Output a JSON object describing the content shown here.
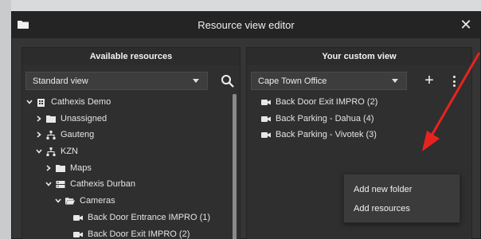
{
  "dialog": {
    "title": "Resource view editor",
    "close_label": "✕"
  },
  "left_panel": {
    "header": "Available resources",
    "view_select": "Standard view",
    "tree": [
      {
        "label": "Cathexis Demo",
        "icon": "building-icon",
        "expanded": true
      },
      {
        "label": "Unassigned",
        "icon": "folder-icon",
        "expanded": false
      },
      {
        "label": "Gauteng",
        "icon": "network-icon",
        "expanded": false
      },
      {
        "label": "KZN",
        "icon": "network-icon",
        "expanded": true
      },
      {
        "label": "Maps",
        "icon": "folder-icon",
        "expanded": false
      },
      {
        "label": "Cathexis Durban",
        "icon": "server-icon",
        "expanded": true
      },
      {
        "label": "Cameras",
        "icon": "folder-icon",
        "expanded": true
      },
      {
        "label": "Back Door Entrance IMPRO (1)",
        "icon": "camera-icon"
      },
      {
        "label": "Back Door Exit IMPRO (2)",
        "icon": "camera-icon"
      }
    ]
  },
  "right_panel": {
    "header": "Your custom view",
    "view_select": "Cape Town Office",
    "plus_label": "+",
    "items": [
      {
        "label": "Back Door Exit IMPRO (2)",
        "icon": "camera-icon"
      },
      {
        "label": "Back Parking - Dahua (4)",
        "icon": "camera-icon"
      },
      {
        "label": "Back Parking - Vivotek (3)",
        "icon": "camera-icon"
      }
    ]
  },
  "context_menu": {
    "items": [
      "Add new folder",
      "Add resources"
    ]
  },
  "colors": {
    "dialog_bg": "#353535",
    "titlebar_bg": "#242424",
    "panel_bg": "#2f2f2f",
    "annotation_arrow": "#e8231f"
  }
}
